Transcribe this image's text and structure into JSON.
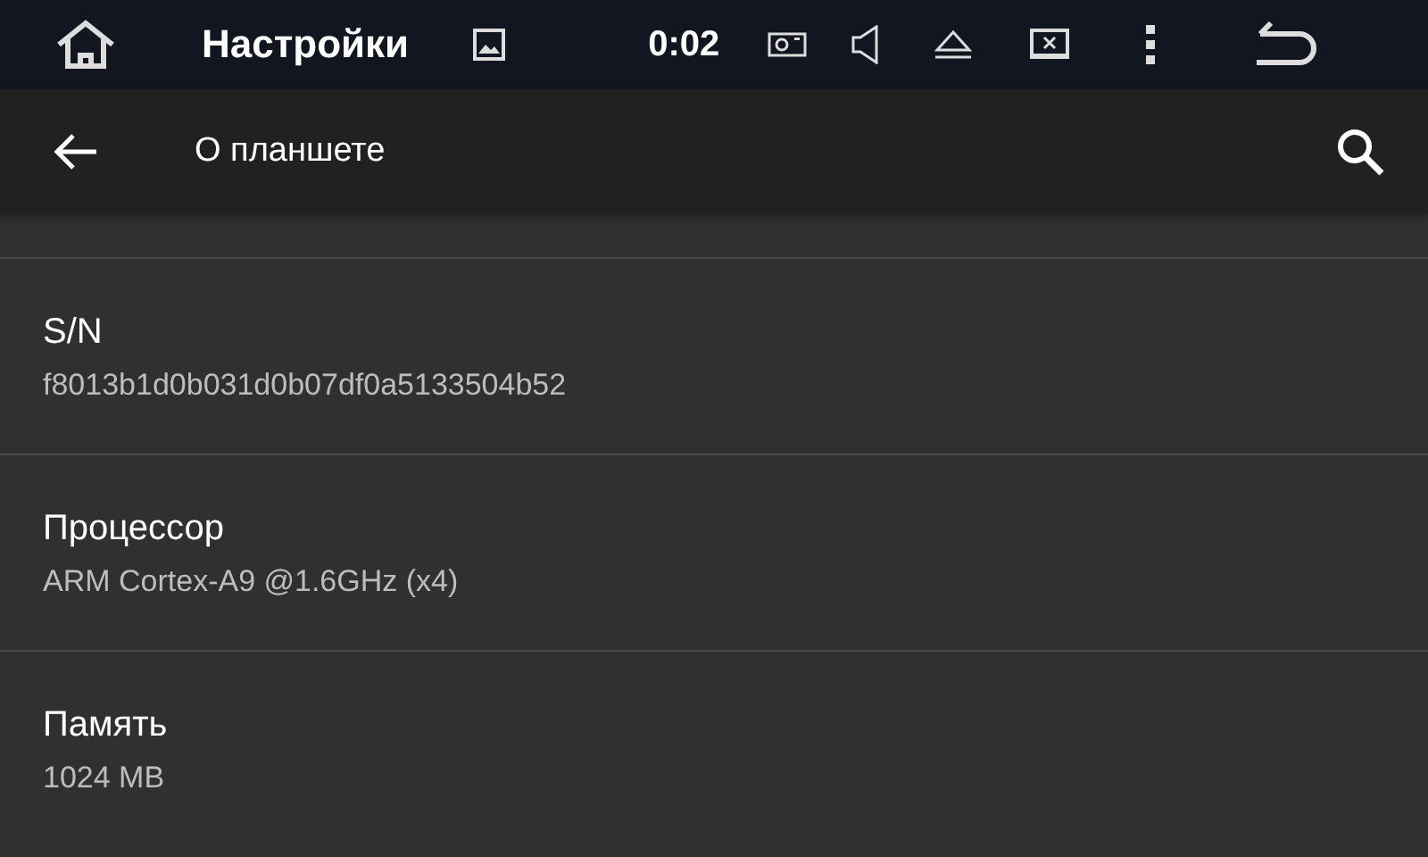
{
  "status_bar": {
    "title": "Настройки",
    "time": "0:02"
  },
  "toolbar": {
    "title": "О планшете"
  },
  "items": [
    {
      "title": "S/N",
      "summary": "f8013b1d0b031d0b07df0a5133504b52"
    },
    {
      "title": "Процессор",
      "summary": "ARM Cortex-A9 @1.6GHz (x4)"
    },
    {
      "title": "Память",
      "summary": "1024 MB"
    }
  ]
}
